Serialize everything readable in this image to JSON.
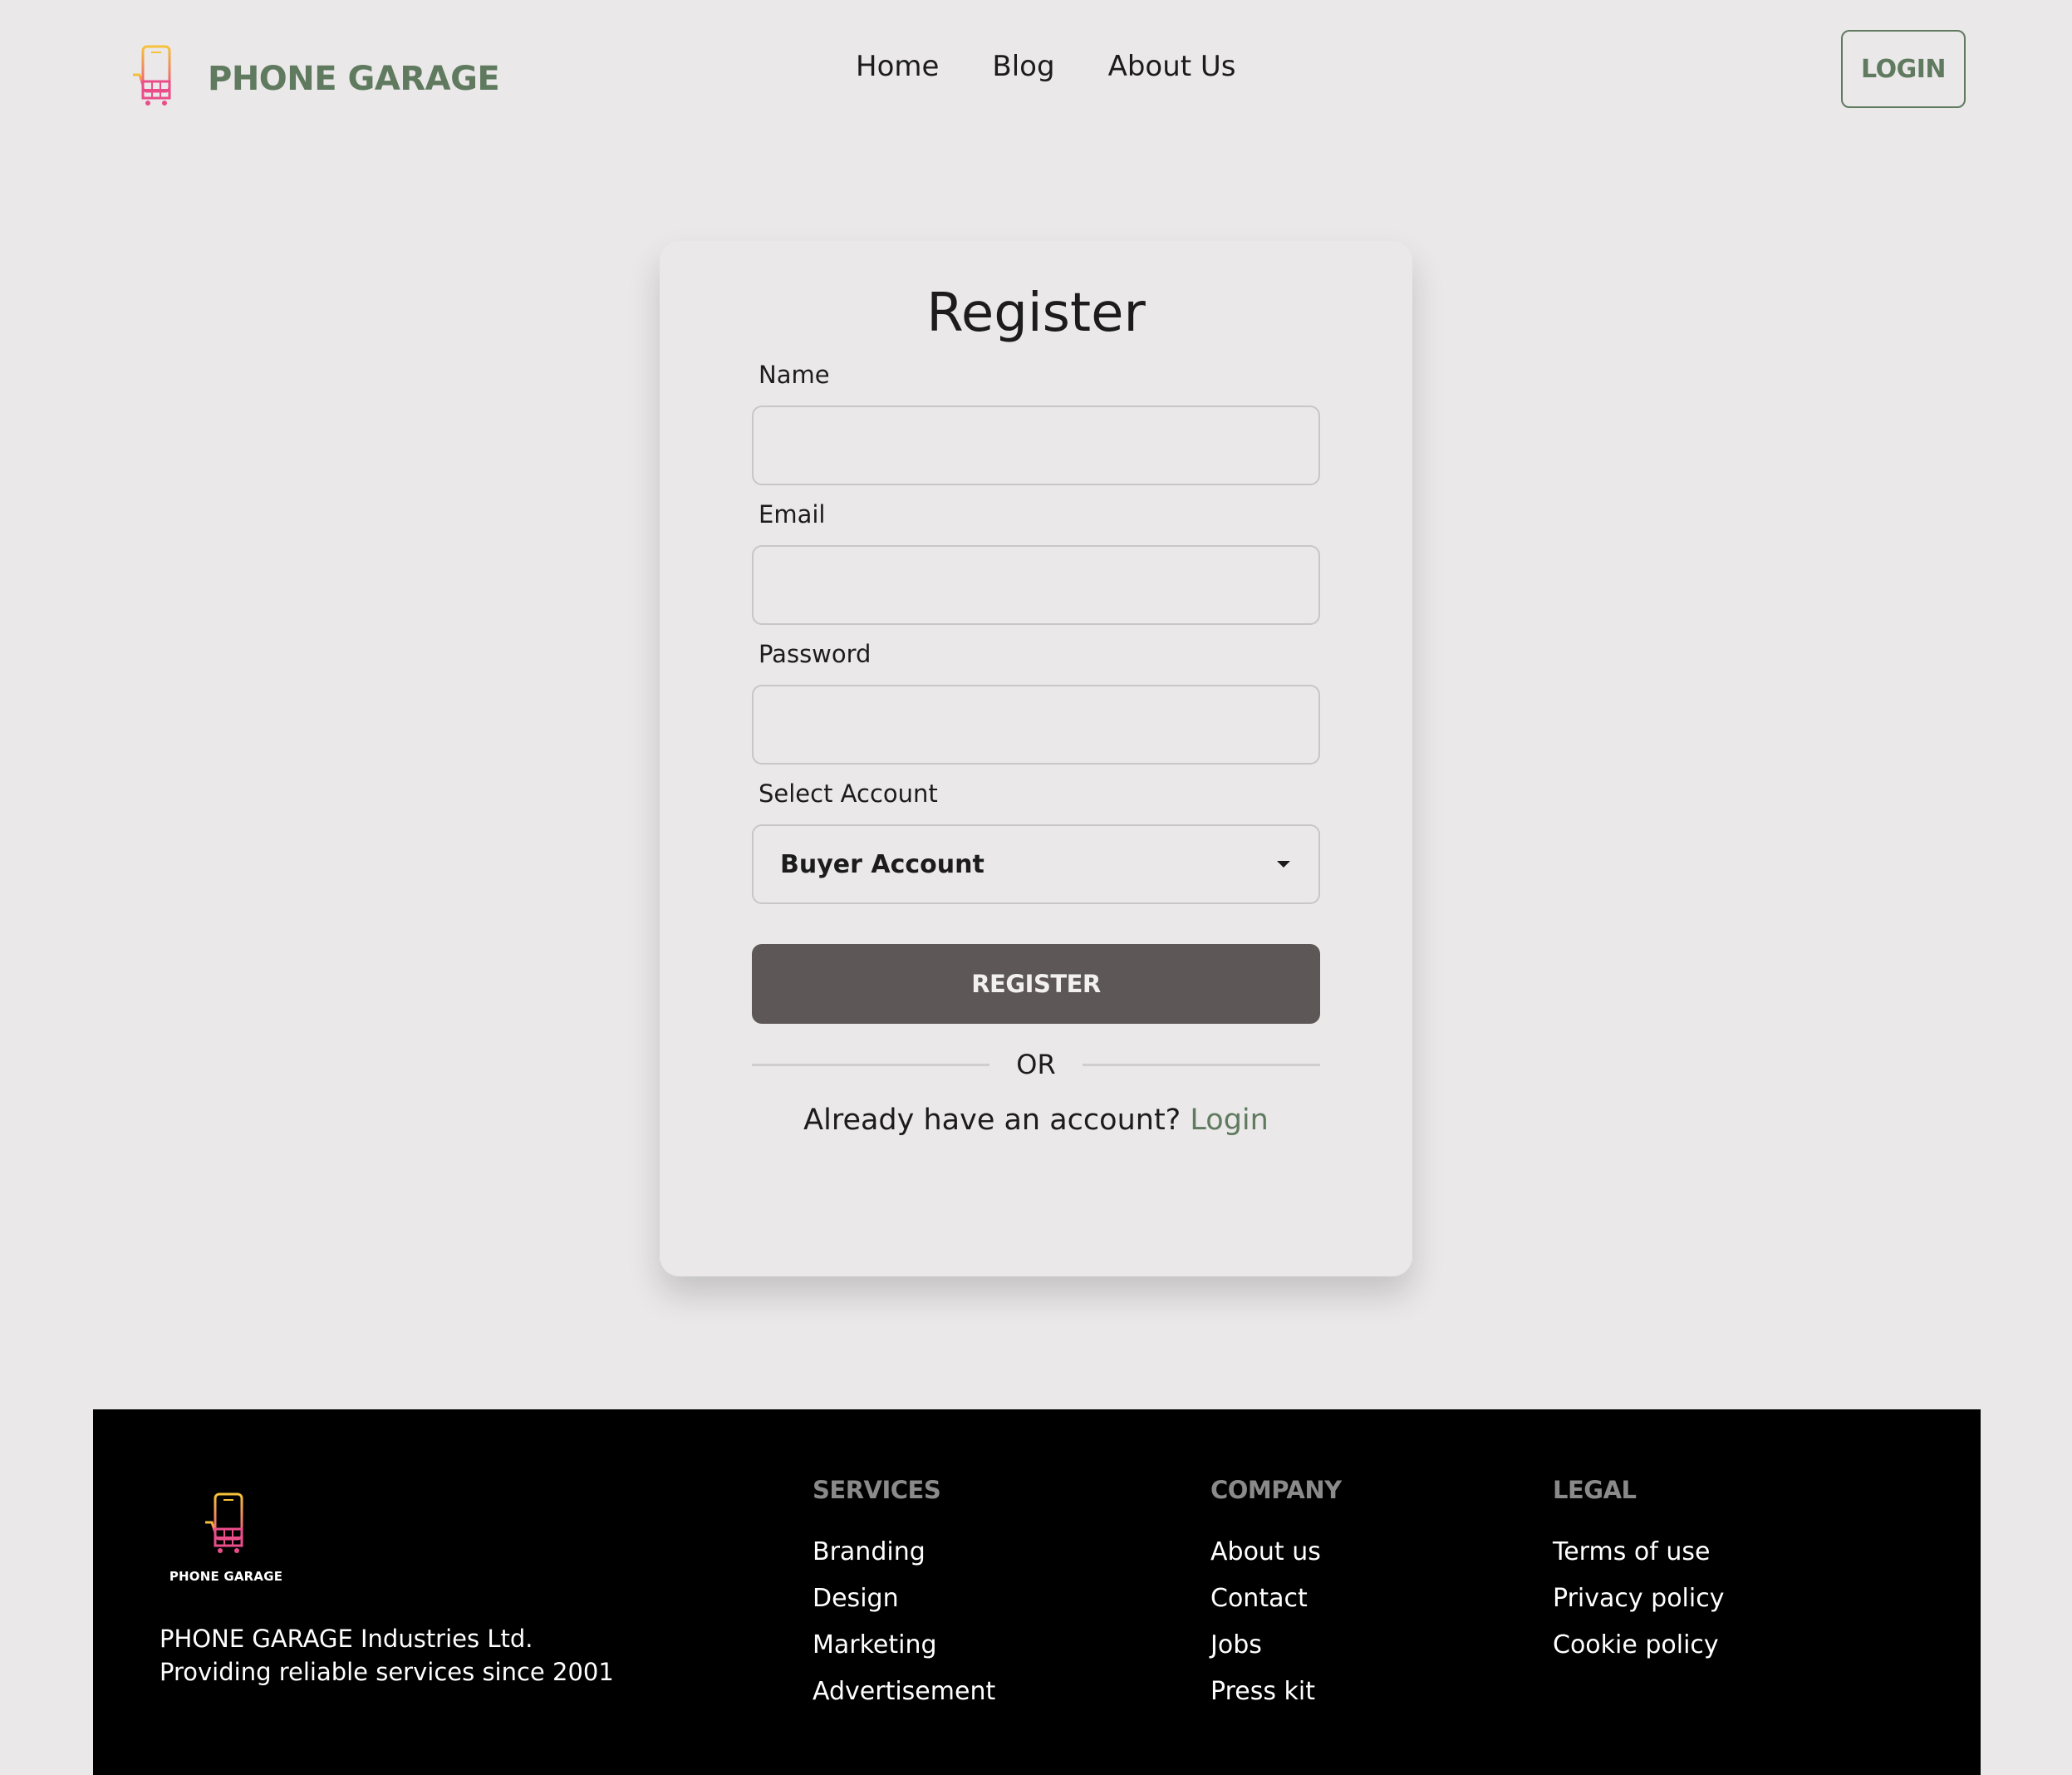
{
  "colors": {
    "background": "#eae8e8",
    "brand_green": "#5f7a5f",
    "register_button": "#5e5758",
    "footer_background": "#000000",
    "footer_heading": "#8a8a8a"
  },
  "header": {
    "brand_name": "PHONE GARAGE",
    "logo_icon": "phone-cart-icon",
    "nav": [
      "Home",
      "Blog",
      "About Us"
    ],
    "login_label": "LOGIN"
  },
  "form": {
    "title": "Register",
    "name_label": "Name",
    "name_value": "",
    "email_label": "Email",
    "email_value": "",
    "password_label": "Password",
    "password_value": "",
    "account_label": "Select Account",
    "account_selected": "Buyer Account",
    "submit_label": "REGISTER",
    "divider_text": "OR",
    "already_text": "Already have an account?",
    "login_link": "Login"
  },
  "footer": {
    "logo_caption": "PHONE GARAGE",
    "about_line1": "PHONE GARAGE Industries Ltd.",
    "about_line2": "Providing reliable services since 2001",
    "columns": [
      {
        "title": "SERVICES",
        "links": [
          "Branding",
          "Design",
          "Marketing",
          "Advertisement"
        ]
      },
      {
        "title": "COMPANY",
        "links": [
          "About us",
          "Contact",
          "Jobs",
          "Press kit"
        ]
      },
      {
        "title": "LEGAL",
        "links": [
          "Terms of use",
          "Privacy policy",
          "Cookie policy"
        ]
      }
    ]
  }
}
